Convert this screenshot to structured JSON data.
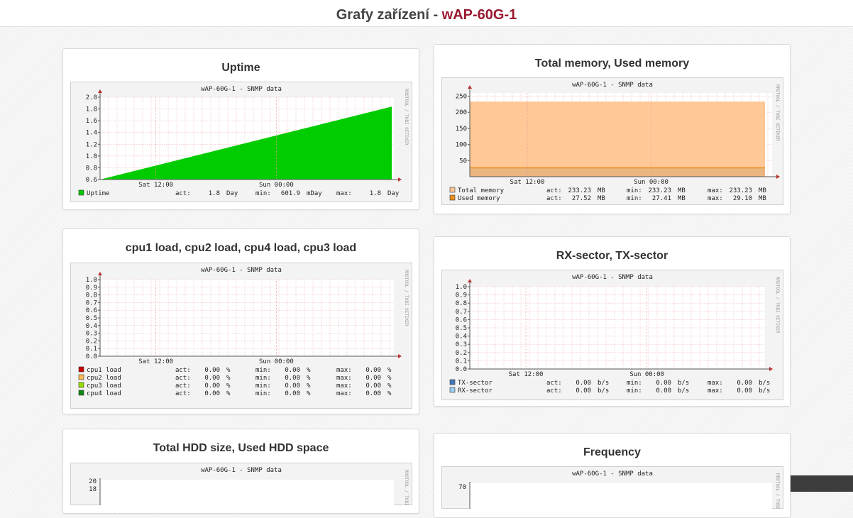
{
  "header": {
    "prefix": "Grafy zařízení - ",
    "device": "wAP-60G-1"
  },
  "graph_subtitle": "wAP-60G-1 - SNMP data",
  "side_label": "RRDTOOL / TOBI OETIKER",
  "x_ticks": [
    "Sat 12:00",
    "Sun 00:00"
  ],
  "cards": [
    {
      "title": "Uptime",
      "chart_data": {
        "type": "area",
        "title": "wAP-60G-1 - SNMP data",
        "y_ticks": [
          "0.6",
          "0.8",
          "1.0",
          "1.2",
          "1.4",
          "1.6",
          "1.8",
          "2.0"
        ],
        "ylim": [
          0.6,
          2.0
        ],
        "x_ticks": [
          "Sat 12:00",
          "Sun 00:00"
        ],
        "series": [
          {
            "name": "Uptime",
            "color": "#00cc00",
            "start": 0.6,
            "end": 1.84,
            "act": "1.8",
            "act_unit": "Day",
            "min": "601.9",
            "min_unit": "mDay",
            "max": "1.8",
            "max_unit": "Day"
          }
        ]
      }
    },
    {
      "title": "Total memory, Used memory",
      "chart_data": {
        "type": "area",
        "title": "wAP-60G-1 - SNMP data",
        "y_ticks": [
          "50",
          "100",
          "150",
          "200",
          "250"
        ],
        "ylim": [
          0,
          260
        ],
        "x_ticks": [
          "Sat 12:00",
          "Sun 00:00"
        ],
        "series": [
          {
            "name": "Total memory",
            "color": "#ffc896",
            "value": 233.23,
            "act": "233.23",
            "act_unit": "MB",
            "min": "233.23",
            "min_unit": "MB",
            "max": "233.23",
            "max_unit": "MB"
          },
          {
            "name": "Used memory",
            "color": "#e8901e",
            "value": 27.52,
            "act": "27.52",
            "act_unit": "MB",
            "min": "27.41",
            "min_unit": "MB",
            "max": "29.10",
            "max_unit": "MB"
          }
        ]
      }
    },
    {
      "title": "cpu1 load, cpu2 load, cpu4 load, cpu3 load",
      "chart_data": {
        "type": "line",
        "title": "wAP-60G-1 - SNMP data",
        "y_ticks": [
          "0.0",
          "0.1",
          "0.2",
          "0.3",
          "0.4",
          "0.5",
          "0.6",
          "0.7",
          "0.8",
          "0.9",
          "1.0"
        ],
        "ylim": [
          0,
          1.0
        ],
        "x_ticks": [
          "Sat 12:00",
          "Sun 00:00"
        ],
        "series": [
          {
            "name": "cpu1 load",
            "color": "#cc0000",
            "act": "0.00",
            "act_unit": "%",
            "min": "0.00",
            "min_unit": "%",
            "max": "0.00",
            "max_unit": "%"
          },
          {
            "name": "cpu2 load",
            "color": "#ffbb55",
            "act": "0.00",
            "act_unit": "%",
            "min": "0.00",
            "min_unit": "%",
            "max": "0.00",
            "max_unit": "%"
          },
          {
            "name": "cpu3 load",
            "color": "#99dd00",
            "act": "0.00",
            "act_unit": "%",
            "min": "0.00",
            "min_unit": "%",
            "max": "0.00",
            "max_unit": "%"
          },
          {
            "name": "cpu4 load",
            "color": "#118811",
            "act": "0.00",
            "act_unit": "%",
            "min": "0.00",
            "min_unit": "%",
            "max": "0.00",
            "max_unit": "%"
          }
        ]
      }
    },
    {
      "title": "RX-sector, TX-sector",
      "chart_data": {
        "type": "line",
        "title": "wAP-60G-1 - SNMP data",
        "y_ticks": [
          "0.0",
          "0.1",
          "0.2",
          "0.3",
          "0.4",
          "0.5",
          "0.6",
          "0.7",
          "0.8",
          "0.9",
          "1.0"
        ],
        "ylim": [
          0,
          1.0
        ],
        "x_ticks": [
          "Sat 12:00",
          "Sun 00:00"
        ],
        "series": [
          {
            "name": "TX-sector",
            "color": "#4477bb",
            "act": "0.00",
            "act_unit": "b/s",
            "min": "0.00",
            "min_unit": "b/s",
            "max": "0.00",
            "max_unit": "b/s"
          },
          {
            "name": "RX-sector",
            "color": "#99ccee",
            "act": "0.00",
            "act_unit": "b/s",
            "min": "0.00",
            "min_unit": "b/s",
            "max": "0.00",
            "max_unit": "b/s"
          }
        ]
      }
    },
    {
      "title": "Total HDD size, Used HDD space",
      "chart_data": {
        "type": "area",
        "title": "wAP-60G-1 - SNMP data",
        "y_ticks": [
          "18",
          "20"
        ],
        "series": []
      }
    },
    {
      "title": "Frequency",
      "chart_data": {
        "type": "line",
        "title": "wAP-60G-1 - SNMP data",
        "y_ticks": [
          "70"
        ],
        "series": []
      }
    }
  ]
}
